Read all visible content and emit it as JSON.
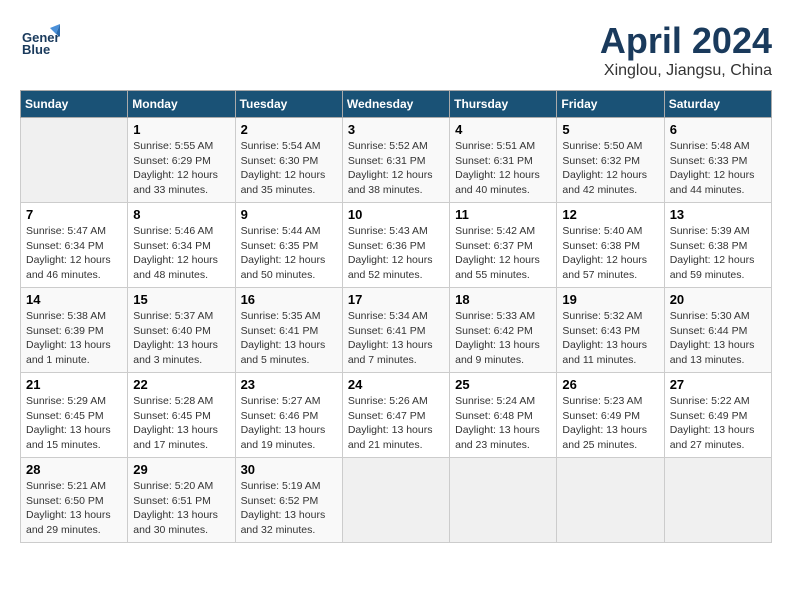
{
  "logo": {
    "line1": "General",
    "line2": "Blue"
  },
  "title": "April 2024",
  "subtitle": "Xinglou, Jiangsu, China",
  "headers": [
    "Sunday",
    "Monday",
    "Tuesday",
    "Wednesday",
    "Thursday",
    "Friday",
    "Saturday"
  ],
  "weeks": [
    [
      {
        "num": "",
        "detail": ""
      },
      {
        "num": "1",
        "detail": "Sunrise: 5:55 AM\nSunset: 6:29 PM\nDaylight: 12 hours\nand 33 minutes."
      },
      {
        "num": "2",
        "detail": "Sunrise: 5:54 AM\nSunset: 6:30 PM\nDaylight: 12 hours\nand 35 minutes."
      },
      {
        "num": "3",
        "detail": "Sunrise: 5:52 AM\nSunset: 6:31 PM\nDaylight: 12 hours\nand 38 minutes."
      },
      {
        "num": "4",
        "detail": "Sunrise: 5:51 AM\nSunset: 6:31 PM\nDaylight: 12 hours\nand 40 minutes."
      },
      {
        "num": "5",
        "detail": "Sunrise: 5:50 AM\nSunset: 6:32 PM\nDaylight: 12 hours\nand 42 minutes."
      },
      {
        "num": "6",
        "detail": "Sunrise: 5:48 AM\nSunset: 6:33 PM\nDaylight: 12 hours\nand 44 minutes."
      }
    ],
    [
      {
        "num": "7",
        "detail": "Sunrise: 5:47 AM\nSunset: 6:34 PM\nDaylight: 12 hours\nand 46 minutes."
      },
      {
        "num": "8",
        "detail": "Sunrise: 5:46 AM\nSunset: 6:34 PM\nDaylight: 12 hours\nand 48 minutes."
      },
      {
        "num": "9",
        "detail": "Sunrise: 5:44 AM\nSunset: 6:35 PM\nDaylight: 12 hours\nand 50 minutes."
      },
      {
        "num": "10",
        "detail": "Sunrise: 5:43 AM\nSunset: 6:36 PM\nDaylight: 12 hours\nand 52 minutes."
      },
      {
        "num": "11",
        "detail": "Sunrise: 5:42 AM\nSunset: 6:37 PM\nDaylight: 12 hours\nand 55 minutes."
      },
      {
        "num": "12",
        "detail": "Sunrise: 5:40 AM\nSunset: 6:38 PM\nDaylight: 12 hours\nand 57 minutes."
      },
      {
        "num": "13",
        "detail": "Sunrise: 5:39 AM\nSunset: 6:38 PM\nDaylight: 12 hours\nand 59 minutes."
      }
    ],
    [
      {
        "num": "14",
        "detail": "Sunrise: 5:38 AM\nSunset: 6:39 PM\nDaylight: 13 hours\nand 1 minute."
      },
      {
        "num": "15",
        "detail": "Sunrise: 5:37 AM\nSunset: 6:40 PM\nDaylight: 13 hours\nand 3 minutes."
      },
      {
        "num": "16",
        "detail": "Sunrise: 5:35 AM\nSunset: 6:41 PM\nDaylight: 13 hours\nand 5 minutes."
      },
      {
        "num": "17",
        "detail": "Sunrise: 5:34 AM\nSunset: 6:41 PM\nDaylight: 13 hours\nand 7 minutes."
      },
      {
        "num": "18",
        "detail": "Sunrise: 5:33 AM\nSunset: 6:42 PM\nDaylight: 13 hours\nand 9 minutes."
      },
      {
        "num": "19",
        "detail": "Sunrise: 5:32 AM\nSunset: 6:43 PM\nDaylight: 13 hours\nand 11 minutes."
      },
      {
        "num": "20",
        "detail": "Sunrise: 5:30 AM\nSunset: 6:44 PM\nDaylight: 13 hours\nand 13 minutes."
      }
    ],
    [
      {
        "num": "21",
        "detail": "Sunrise: 5:29 AM\nSunset: 6:45 PM\nDaylight: 13 hours\nand 15 minutes."
      },
      {
        "num": "22",
        "detail": "Sunrise: 5:28 AM\nSunset: 6:45 PM\nDaylight: 13 hours\nand 17 minutes."
      },
      {
        "num": "23",
        "detail": "Sunrise: 5:27 AM\nSunset: 6:46 PM\nDaylight: 13 hours\nand 19 minutes."
      },
      {
        "num": "24",
        "detail": "Sunrise: 5:26 AM\nSunset: 6:47 PM\nDaylight: 13 hours\nand 21 minutes."
      },
      {
        "num": "25",
        "detail": "Sunrise: 5:24 AM\nSunset: 6:48 PM\nDaylight: 13 hours\nand 23 minutes."
      },
      {
        "num": "26",
        "detail": "Sunrise: 5:23 AM\nSunset: 6:49 PM\nDaylight: 13 hours\nand 25 minutes."
      },
      {
        "num": "27",
        "detail": "Sunrise: 5:22 AM\nSunset: 6:49 PM\nDaylight: 13 hours\nand 27 minutes."
      }
    ],
    [
      {
        "num": "28",
        "detail": "Sunrise: 5:21 AM\nSunset: 6:50 PM\nDaylight: 13 hours\nand 29 minutes."
      },
      {
        "num": "29",
        "detail": "Sunrise: 5:20 AM\nSunset: 6:51 PM\nDaylight: 13 hours\nand 30 minutes."
      },
      {
        "num": "30",
        "detail": "Sunrise: 5:19 AM\nSunset: 6:52 PM\nDaylight: 13 hours\nand 32 minutes."
      },
      {
        "num": "",
        "detail": ""
      },
      {
        "num": "",
        "detail": ""
      },
      {
        "num": "",
        "detail": ""
      },
      {
        "num": "",
        "detail": ""
      }
    ]
  ]
}
